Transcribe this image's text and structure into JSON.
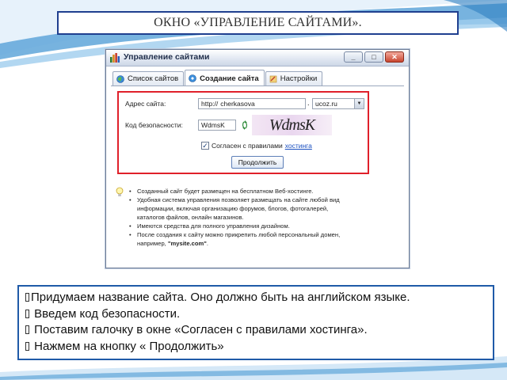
{
  "slide": {
    "title": "ОКНО «УПРАВЛЕНИЕ САЙТАМИ».",
    "colors": {
      "accent_blue": "#1f5aa8",
      "highlight_red": "#e0202a",
      "swoosh_blue": "#5fa6d9"
    }
  },
  "window": {
    "title": "Управление сайтами",
    "controls": {
      "minimize": "_",
      "maximize": "□",
      "close": "✕"
    },
    "tabs": [
      {
        "label": "Список сайтов",
        "icon": "globe-icon",
        "active": false
      },
      {
        "label": "Создание сайта",
        "icon": "create-site-icon",
        "active": true
      },
      {
        "label": "Настройки",
        "icon": "settings-icon",
        "active": false
      }
    ],
    "form": {
      "address_label": "Адрес сайта:",
      "address_prefix": "http://",
      "address_value": "cherkasova",
      "dot": ".",
      "domain_value": "ucoz.ru",
      "code_label": "Код безопасности:",
      "code_value": "WdmsK",
      "captcha_text": "WdmsK",
      "agree_text": "Согласен с правилами",
      "agree_link": "хостинга",
      "agree_checked": true,
      "continue_label": "Продолжить"
    },
    "info": [
      "Созданный сайт будет размещен на бесплатном Веб-хостинге.",
      "Удобная система управления позволяет размещать на сайте любой вид",
      "информации, включая организацию форумов, блогов, фотогалерей,",
      "каталогов файлов, онлайн магазинов.",
      "Имеются средства для полного управления дизайном.",
      "После создания к сайту можно прикрепить любой персональный домен,",
      "например, ",
      "\"mysite.com\"",
      "."
    ]
  },
  "instructions": [
    "Придумаем название сайта. Оно должно быть на английском языке.",
    " Введем код безопасности.",
    " Поставим галочку в окне «Согласен с правилами хостинга».",
    " Нажмем на кнопку « Продолжить»"
  ]
}
